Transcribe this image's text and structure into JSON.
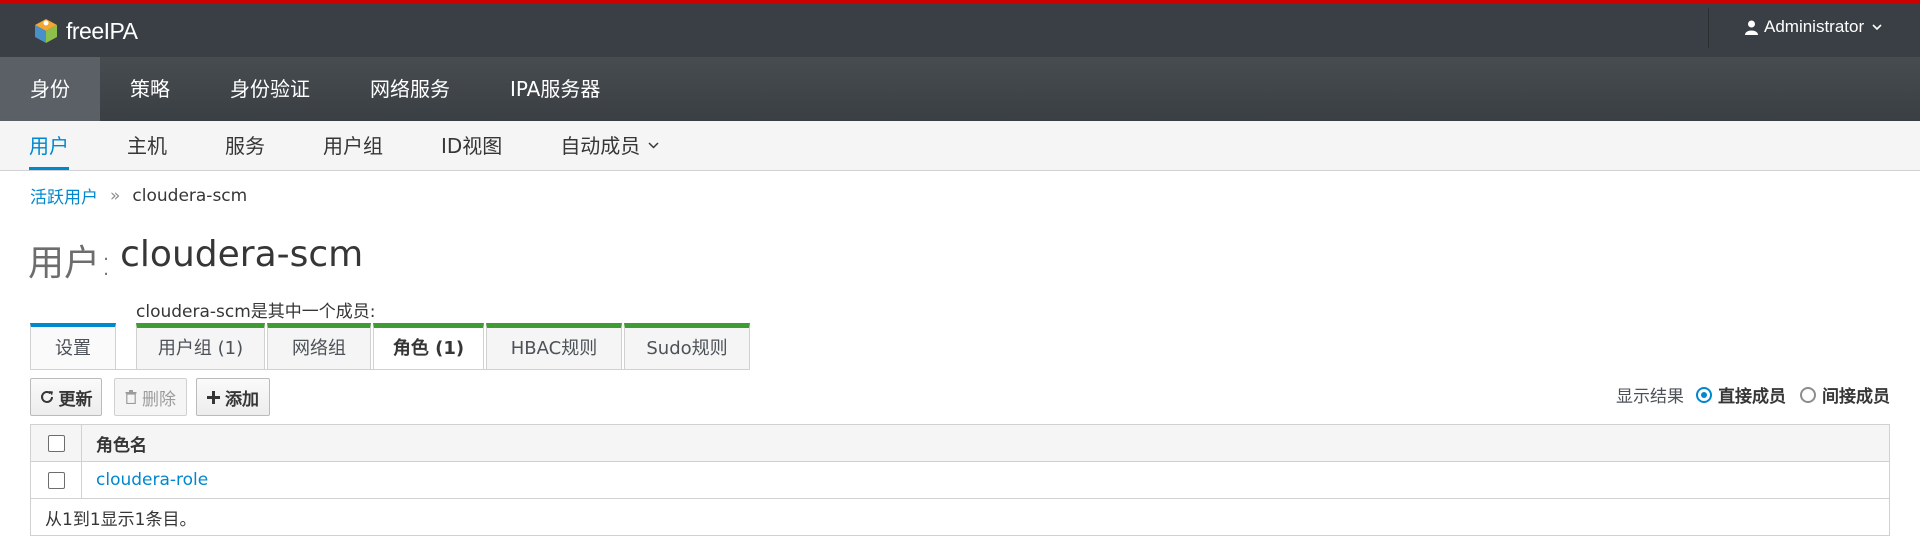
{
  "brand": {
    "name": "freeIPA"
  },
  "user_menu": {
    "label": "Administrator"
  },
  "primary_nav": [
    {
      "label": "身份"
    },
    {
      "label": "策略"
    },
    {
      "label": "身份验证"
    },
    {
      "label": "网络服务"
    },
    {
      "label": "IPA服务器"
    }
  ],
  "secondary_nav": [
    {
      "label": "用户"
    },
    {
      "label": "主机"
    },
    {
      "label": "服务"
    },
    {
      "label": "用户组"
    },
    {
      "label": "ID视图"
    },
    {
      "label": "自动成员"
    }
  ],
  "breadcrumb": {
    "parent": "活跃用户",
    "separator": "»",
    "current": "cloudera-scm"
  },
  "page": {
    "title_prefix": "用户:",
    "title_name": "cloudera-scm",
    "member_caption": "cloudera-scm是其中一个成员:"
  },
  "facet_tabs": {
    "settings": "设置",
    "groups": "用户组 (1)",
    "netgroups": "网络组",
    "roles": "角色 (1)",
    "hbac": "HBAC规则",
    "sudo": "Sudo规则"
  },
  "toolbar": {
    "refresh": "更新",
    "delete": "删除",
    "add": "添加"
  },
  "display_results": {
    "label": "显示结果",
    "direct": "直接成员",
    "indirect": "间接成员",
    "selected": "direct"
  },
  "table": {
    "header": "角色名",
    "rows": [
      {
        "name": "cloudera-role"
      }
    ],
    "footer": "从1到1显示1条目。"
  },
  "colors": {
    "accent": "#0088ce",
    "header_bg": "#393f44",
    "top_border": "#cc0000",
    "member_tab": "#3f9c35"
  }
}
